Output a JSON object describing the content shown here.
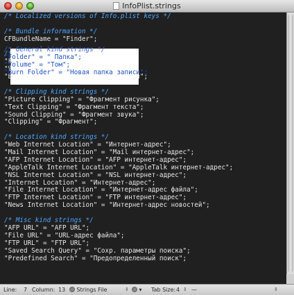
{
  "window": {
    "title": "InfoPlist.strings"
  },
  "editor": {
    "lines": [
      {
        "text": "/* Localized versions of Info.plist keys */",
        "kind": "comment"
      },
      {
        "text": "",
        "kind": "blank"
      },
      {
        "text": "/* Bundle information */",
        "kind": "comment"
      },
      {
        "text": "CFBundleName = \"Finder\";",
        "kind": "code"
      },
      {
        "text": "",
        "kind": "blank"
      },
      {
        "text": "/* General kind strings */",
        "kind": "comment"
      },
      {
        "text": "\"Folder\" = \" Папка\";",
        "kind": "code"
      },
      {
        "text": "\"Volume\" = \"Том\";",
        "kind": "code"
      },
      {
        "text": "\"Burn Folder\" = \"Новая папка записи\";",
        "kind": "code"
      },
      {
        "text": "",
        "kind": "blank"
      },
      {
        "text": "/* Clipping kind strings */",
        "kind": "comment"
      },
      {
        "text": "\"Picture Clipping\" = \"Фрагмент рисунка\";",
        "kind": "code"
      },
      {
        "text": "\"Text Clipping\" = \"Фрагмент текста\";",
        "kind": "code"
      },
      {
        "text": "\"Sound Clipping\" = \"Фрагмент звука\";",
        "kind": "code"
      },
      {
        "text": "\"Clipping\" = \"Фрагмент\";",
        "kind": "code"
      },
      {
        "text": "",
        "kind": "blank"
      },
      {
        "text": "/* Location kind strings */",
        "kind": "comment"
      },
      {
        "text": "\"Web Internet Location\" = \"Интернет-адрес\";",
        "kind": "code"
      },
      {
        "text": "\"Mail Internet Location\" = \"Mail интернет-адрес\";",
        "kind": "code"
      },
      {
        "text": "\"AFP Internet Location\" = \"AFP интернет-адрес\";",
        "kind": "code"
      },
      {
        "text": "\"AppleTalk Internet Location\" = \"AppleTalk интернет-адрес\";",
        "kind": "code"
      },
      {
        "text": "\"NSL Internet Location\" = \"NSL интернет-адрес\";",
        "kind": "code"
      },
      {
        "text": "\"Internet Location\" = \"Интернет-адрес\";",
        "kind": "code"
      },
      {
        "text": "\"File Internet Location\" = \"Интернет-адрес файла\";",
        "kind": "code"
      },
      {
        "text": "\"FTP Internet Location\" = \"FTP интернет-адрес\";",
        "kind": "code"
      },
      {
        "text": "\"News Internet Location\" = \"Интернет-адрес новостей\";",
        "kind": "code"
      },
      {
        "text": "",
        "kind": "blank"
      },
      {
        "text": "/* Misc kind strings */",
        "kind": "comment"
      },
      {
        "text": "\"AFP URL\" = \"AFP URL\";",
        "kind": "code"
      },
      {
        "text": "\"File URL\" = \"URL-адрес файла\";",
        "kind": "code"
      },
      {
        "text": "\"FTP URL\" = \"FTP URL\";",
        "kind": "code"
      },
      {
        "text": "\"Saved Search Query\" = \"Сохр. параметры поиска\";",
        "kind": "code"
      },
      {
        "text": "\"Predefined Search\" = \"Предопределенный поиск\";",
        "kind": "code"
      }
    ],
    "highlight": {
      "lines": [
        "/* General kind strings */",
        "\"Folder\" = \" Папка\";",
        "\"Volume\" = \"Том\";",
        "\"Burn Folder\" = \"Новая папка записи\";"
      ]
    }
  },
  "statusbar": {
    "line_label": "Line:",
    "line_value": "7",
    "column_label": "Column:",
    "column_value": "13",
    "file_type": "Strings File",
    "tab_size_label": "Tab Size:",
    "tab_size_value": "4",
    "function_value": "—"
  },
  "colors": {
    "editor_background": "#202020",
    "comment": "#4da6ff",
    "code": "#e8e8e8",
    "selection_background": "#ffffff",
    "selection_text": "#1f4fbf"
  }
}
